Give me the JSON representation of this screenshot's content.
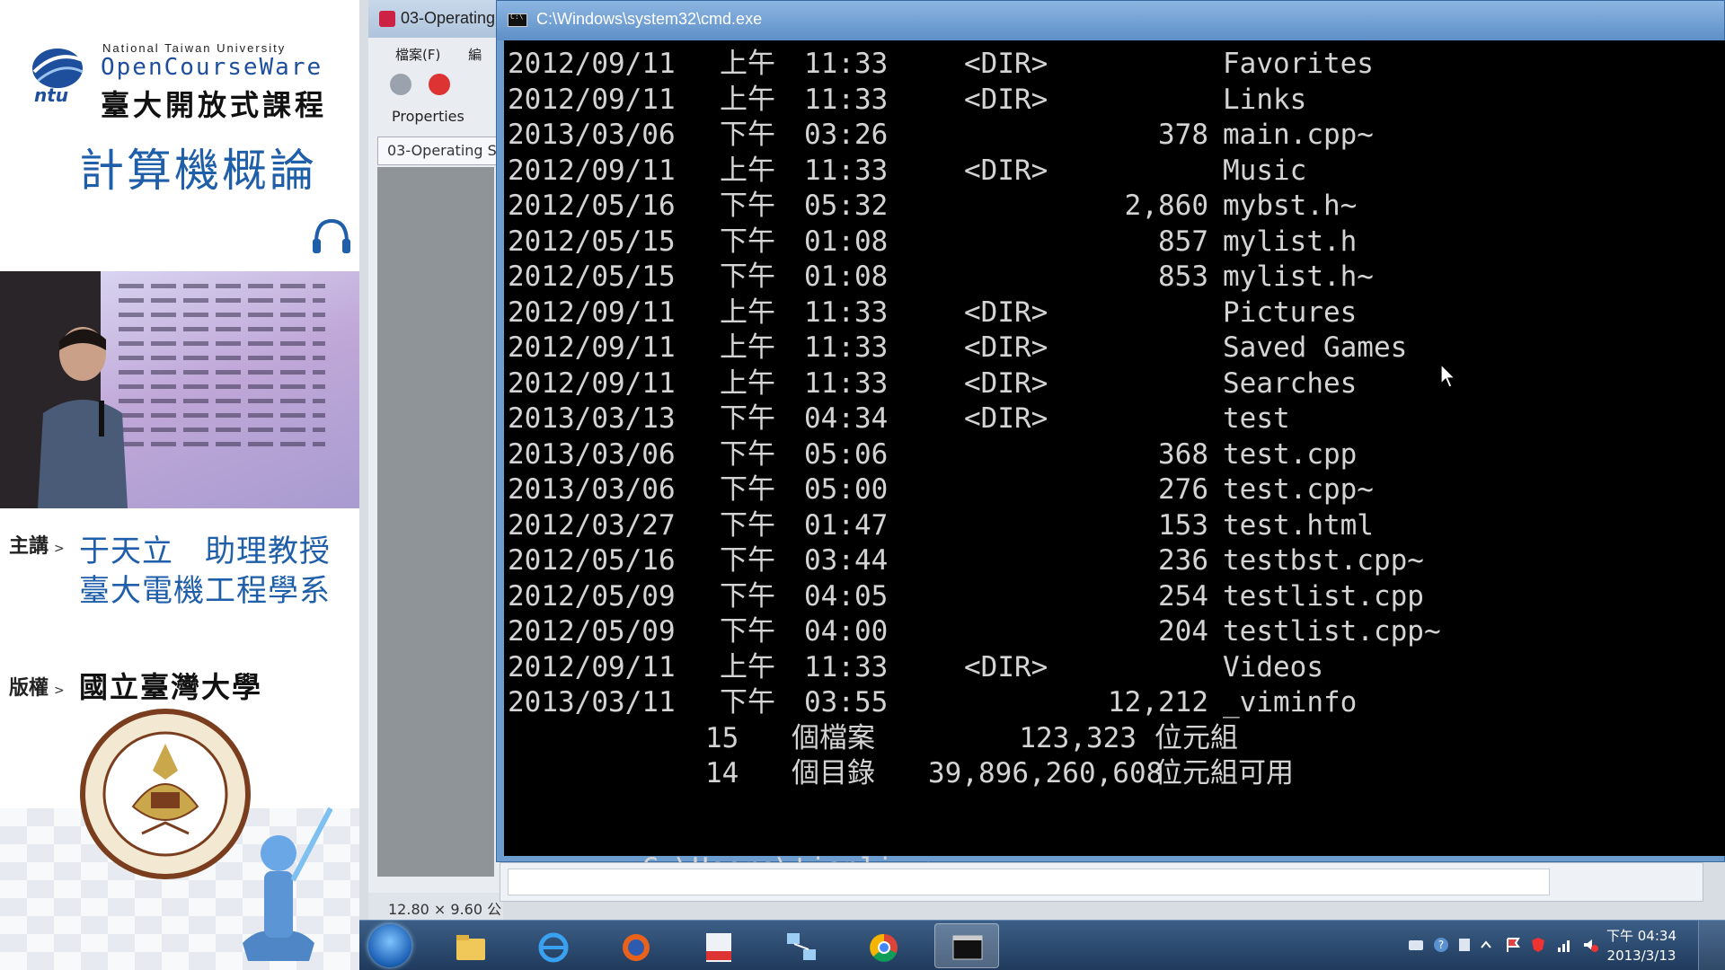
{
  "sidebar": {
    "logo": {
      "university": "National Taiwan University",
      "ocw": "OpenCourseWare",
      "cn": "臺大開放式課程",
      "ntu": "ntu"
    },
    "course_title": "計算機概論",
    "lecturer_label": "主講",
    "lecturer_name": "于天立　助理教授",
    "lecturer_dept": "臺大電機工程學系",
    "copyright_label": "版權",
    "copyright_holder": "國立臺灣大學"
  },
  "bg_window": {
    "title": "03-Operating",
    "menu": [
      "檔案(F)",
      "編"
    ],
    "properties_label": "Properties",
    "tab_label": "03-Operating S",
    "status": "12.80 × 9.60 公"
  },
  "cmd": {
    "title": "C:\\Windows\\system32\\cmd.exe",
    "entries": [
      {
        "date": "2012/09/11",
        "ampm": "上午",
        "time": "11:33",
        "dir": "<DIR>",
        "size": "",
        "name": "Favorites"
      },
      {
        "date": "2012/09/11",
        "ampm": "上午",
        "time": "11:33",
        "dir": "<DIR>",
        "size": "",
        "name": "Links"
      },
      {
        "date": "2013/03/06",
        "ampm": "下午",
        "time": "03:26",
        "dir": "",
        "size": "378",
        "name": "main.cpp~"
      },
      {
        "date": "2012/09/11",
        "ampm": "上午",
        "time": "11:33",
        "dir": "<DIR>",
        "size": "",
        "name": "Music"
      },
      {
        "date": "2012/05/16",
        "ampm": "下午",
        "time": "05:32",
        "dir": "",
        "size": "2,860",
        "name": "mybst.h~"
      },
      {
        "date": "2012/05/15",
        "ampm": "下午",
        "time": "01:08",
        "dir": "",
        "size": "857",
        "name": "mylist.h"
      },
      {
        "date": "2012/05/15",
        "ampm": "下午",
        "time": "01:08",
        "dir": "",
        "size": "853",
        "name": "mylist.h~"
      },
      {
        "date": "2012/09/11",
        "ampm": "上午",
        "time": "11:33",
        "dir": "<DIR>",
        "size": "",
        "name": "Pictures"
      },
      {
        "date": "2012/09/11",
        "ampm": "上午",
        "time": "11:33",
        "dir": "<DIR>",
        "size": "",
        "name": "Saved Games"
      },
      {
        "date": "2012/09/11",
        "ampm": "上午",
        "time": "11:33",
        "dir": "<DIR>",
        "size": "",
        "name": "Searches"
      },
      {
        "date": "2013/03/13",
        "ampm": "下午",
        "time": "04:34",
        "dir": "<DIR>",
        "size": "",
        "name": "test"
      },
      {
        "date": "2013/03/06",
        "ampm": "下午",
        "time": "05:06",
        "dir": "",
        "size": "368",
        "name": "test.cpp"
      },
      {
        "date": "2013/03/06",
        "ampm": "下午",
        "time": "05:00",
        "dir": "",
        "size": "276",
        "name": "test.cpp~"
      },
      {
        "date": "2012/03/27",
        "ampm": "下午",
        "time": "01:47",
        "dir": "",
        "size": "153",
        "name": "test.html"
      },
      {
        "date": "2012/05/16",
        "ampm": "下午",
        "time": "03:44",
        "dir": "",
        "size": "236",
        "name": "testbst.cpp~"
      },
      {
        "date": "2012/05/09",
        "ampm": "下午",
        "time": "04:05",
        "dir": "",
        "size": "254",
        "name": "testlist.cpp"
      },
      {
        "date": "2012/05/09",
        "ampm": "下午",
        "time": "04:00",
        "dir": "",
        "size": "204",
        "name": "testlist.cpp~"
      },
      {
        "date": "2012/09/11",
        "ampm": "上午",
        "time": "11:33",
        "dir": "<DIR>",
        "size": "",
        "name": "Videos"
      },
      {
        "date": "2013/03/11",
        "ampm": "下午",
        "time": "03:55",
        "dir": "",
        "size": "12,212",
        "name": "_viminfo"
      }
    ],
    "summary": [
      {
        "count": "15",
        "label": "個檔案",
        "bytes": "123,323",
        "unit": "位元組"
      },
      {
        "count": "14",
        "label": "個目錄",
        "bytes": "39,896,260,608",
        "unit": "位元組可用"
      }
    ],
    "prompt": "C:\\Users\\tianliyu>"
  },
  "taskbar": {
    "apps": [
      {
        "name": "explorer-icon",
        "active": false
      },
      {
        "name": "internet-explorer-icon",
        "active": false
      },
      {
        "name": "firefox-icon",
        "active": false
      },
      {
        "name": "pdf-icon",
        "active": false
      },
      {
        "name": "network-icon",
        "active": false
      },
      {
        "name": "chrome-icon",
        "active": false
      },
      {
        "name": "cmd-icon",
        "active": true
      }
    ],
    "clock_time": "下午 04:34",
    "clock_date": "2013/3/13"
  },
  "colors": {
    "console_bg": "#000000",
    "console_fg": "#d4d4d4",
    "accent_blue": "#1f5ea8",
    "taskbar": "#2b4a70"
  }
}
